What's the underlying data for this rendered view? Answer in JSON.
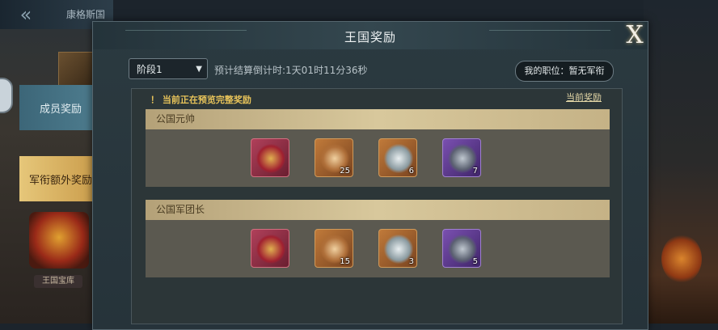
{
  "top": {
    "back_icon": "double-chevron-left-icon",
    "title": "康格斯国"
  },
  "side": {
    "crown_label": "王国宝库"
  },
  "tabs": [
    {
      "label": "成员奖励",
      "active": false
    },
    {
      "label": "军衔额外奖励",
      "active": true
    }
  ],
  "panel": {
    "title": "王国奖励",
    "close_label": "X",
    "stage_select": "阶段1",
    "countdown": "预计结算倒计时:1天01时11分36秒",
    "rank_badge": "我的职位：暂无军衔",
    "notice": "！ 当前正在预览完整奖励",
    "current_link": "当前奖励"
  },
  "groups": [
    {
      "name": "公国元帅",
      "items": [
        {
          "icon": "treasure-chest-icon",
          "quality": "red",
          "qty": ""
        },
        {
          "icon": "golden-helmet-icon",
          "quality": "gold",
          "qty": "25"
        },
        {
          "icon": "rune-stone-icon",
          "quality": "gold",
          "qty": "6"
        },
        {
          "icon": "armor-chest-icon",
          "quality": "purple",
          "qty": "7"
        }
      ]
    },
    {
      "name": "公国军团长",
      "items": [
        {
          "icon": "treasure-chest-icon",
          "quality": "red",
          "qty": ""
        },
        {
          "icon": "golden-helmet-icon",
          "quality": "gold",
          "qty": "15"
        },
        {
          "icon": "rune-stone-icon",
          "quality": "gold",
          "qty": "3"
        },
        {
          "icon": "armor-chest-icon",
          "quality": "purple",
          "qty": "5"
        }
      ]
    }
  ],
  "colors": {
    "accent_gold": "#d8c89c",
    "notice": "#e7c35a",
    "tab_active": "#e6c77a",
    "tab_inactive": "#4f7e90"
  }
}
